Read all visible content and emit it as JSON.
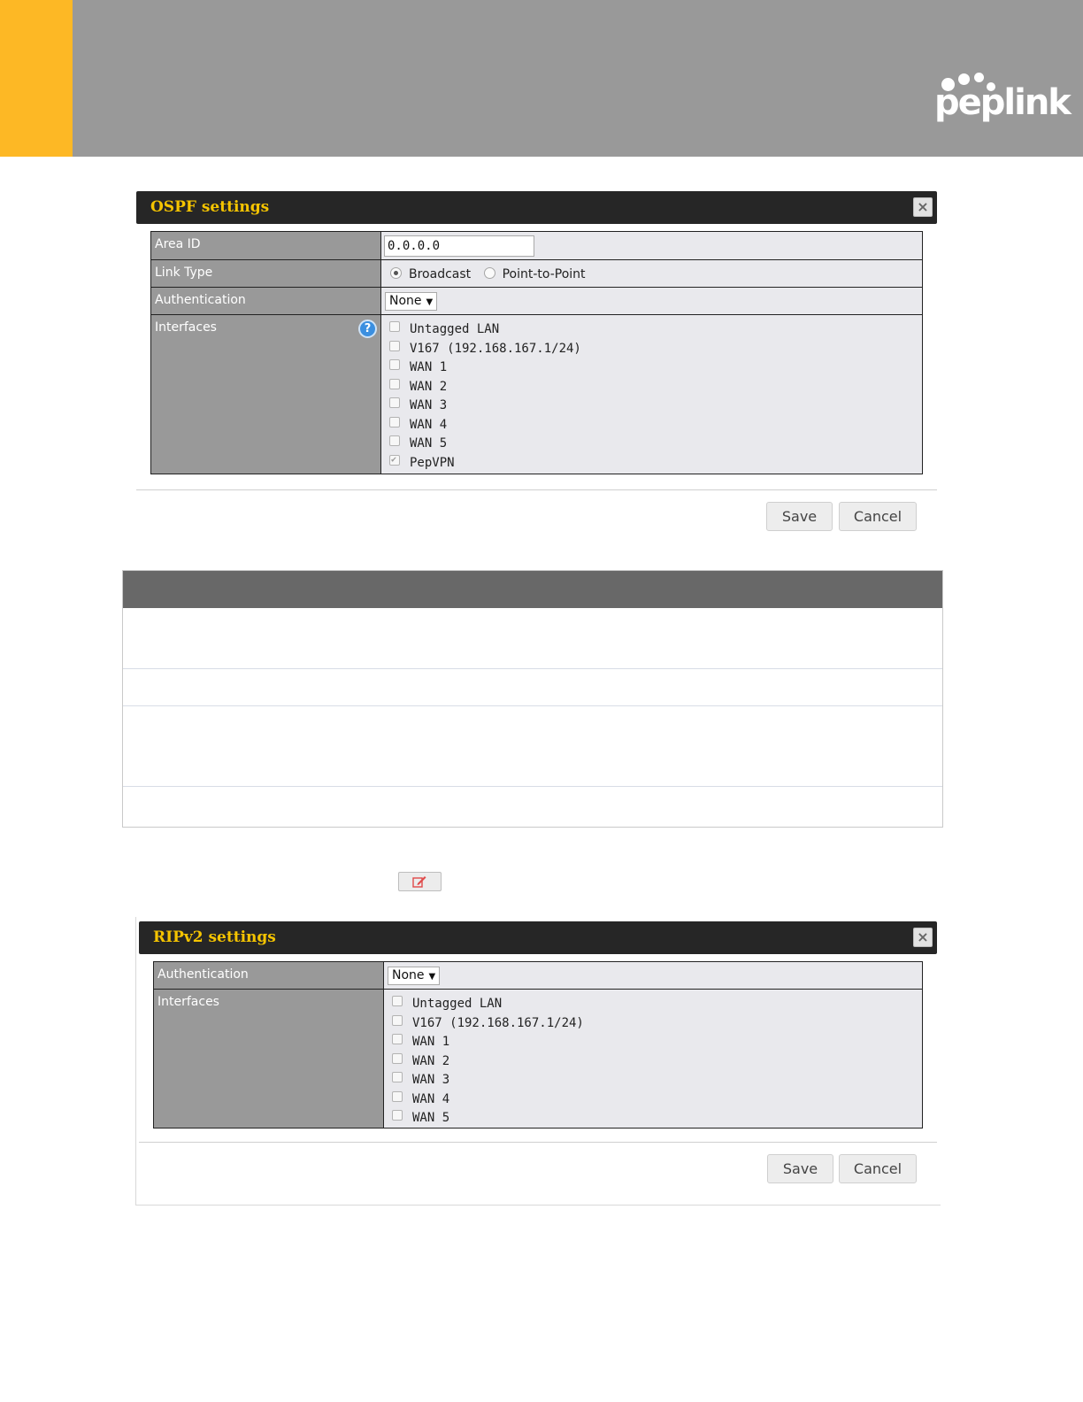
{
  "header": {
    "brand": "peplink",
    "colors": {
      "accent": "#fdb825",
      "band": "#999999"
    }
  },
  "ospf": {
    "title": "OSPF settings",
    "close_icon": "close-icon",
    "rows": {
      "area_id": {
        "label": "Area ID",
        "value": "0.0.0.0"
      },
      "link_type": {
        "label": "Link Type",
        "options": [
          "Broadcast",
          "Point-to-Point"
        ],
        "selected": "Broadcast"
      },
      "authentication": {
        "label": "Authentication",
        "value": "None"
      },
      "interfaces": {
        "label": "Interfaces",
        "help_icon": "help-icon",
        "items": [
          {
            "label": "Untagged LAN",
            "checked": false
          },
          {
            "label": "V167 (192.168.167.1/24)",
            "checked": false
          },
          {
            "label": "WAN 1",
            "checked": false
          },
          {
            "label": "WAN 2",
            "checked": false
          },
          {
            "label": "WAN 3",
            "checked": false
          },
          {
            "label": "WAN 4",
            "checked": false
          },
          {
            "label": "WAN 5",
            "checked": false
          },
          {
            "label": "PepVPN",
            "checked": true
          }
        ]
      }
    },
    "save_label": "Save",
    "cancel_label": "Cancel"
  },
  "edit_button_icon": "edit-icon",
  "rip": {
    "title": "RIPv2 settings",
    "close_icon": "close-icon",
    "rows": {
      "authentication": {
        "label": "Authentication",
        "value": "None"
      },
      "interfaces": {
        "label": "Interfaces",
        "items": [
          {
            "label": "Untagged LAN",
            "checked": false
          },
          {
            "label": "V167 (192.168.167.1/24)",
            "checked": false
          },
          {
            "label": "WAN 1",
            "checked": false
          },
          {
            "label": "WAN 2",
            "checked": false
          },
          {
            "label": "WAN 3",
            "checked": false
          },
          {
            "label": "WAN 4",
            "checked": false
          },
          {
            "label": "WAN 5",
            "checked": false
          }
        ]
      }
    },
    "save_label": "Save",
    "cancel_label": "Cancel"
  }
}
